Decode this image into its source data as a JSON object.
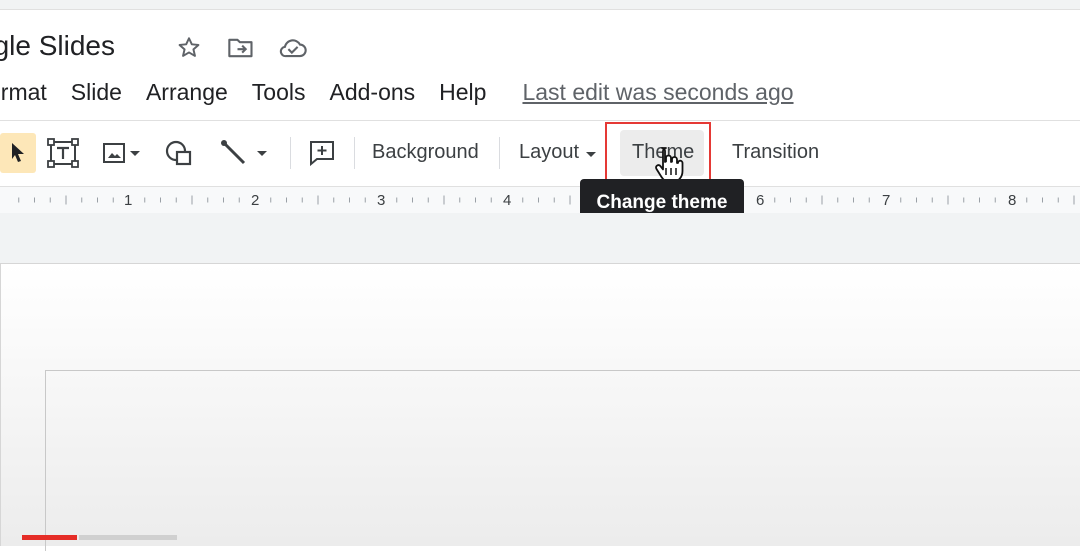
{
  "app": {
    "title": "ogle Slides",
    "title_icons": [
      "star-icon",
      "move-to-folder-icon",
      "cloud-saved-icon"
    ]
  },
  "menu": {
    "items": [
      "ormat",
      "Slide",
      "Arrange",
      "Tools",
      "Add-ons",
      "Help"
    ],
    "last_edit": "Last edit was seconds ago"
  },
  "toolbar": {
    "background": "Background",
    "layout": "Layout",
    "theme": "Theme",
    "transition": "Transition",
    "icons": [
      "cursor-select-icon",
      "text-box-icon",
      "image-icon",
      "shape-icon",
      "line-icon",
      "add-comment-icon"
    ]
  },
  "tooltip": {
    "text": "Change theme"
  },
  "ruler": {
    "labels": [
      "1",
      "2",
      "3",
      "4",
      "6",
      "7",
      "8"
    ]
  },
  "colors": {
    "highlight": "#e53935",
    "tooltip_bg": "#202124",
    "select_bg": "#fde7b8",
    "progress": "#e52d27"
  }
}
